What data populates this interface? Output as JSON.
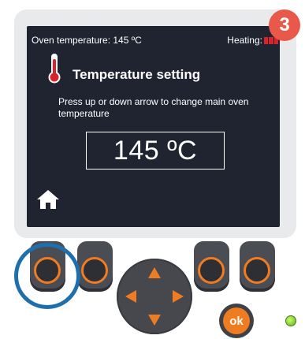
{
  "screen": {
    "oven_temperature_label": "Oven temperature: 145 ºC",
    "heating_label": "Heating:",
    "heating_level": "3 of 3 bars",
    "title": "Temperature setting",
    "description": "Press up or down arrow to change main oven temperature",
    "temperature_value": "145 ºC"
  },
  "step_badge": "3",
  "ok_label": "ok",
  "icons": {
    "thermometer": "thermometer-icon",
    "home": "home-icon",
    "heating_indicator": "heating-bars-icon"
  },
  "colors": {
    "accent_orange": "#f07c22",
    "highlight_blue": "#1e6fae",
    "badge_red": "#e8594a",
    "heating_red": "#d9232a",
    "screen_bg": "#1f2430",
    "led_green": "#5fae18"
  }
}
